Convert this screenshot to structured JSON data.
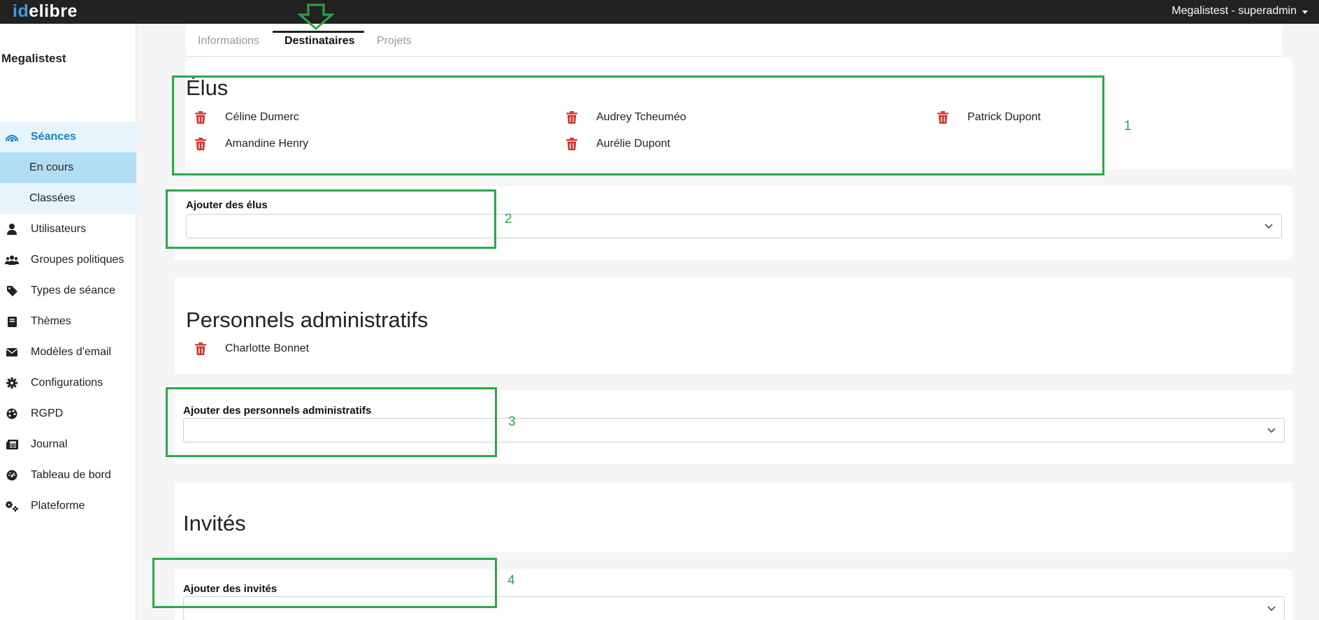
{
  "topbar": {
    "logo_id": "id",
    "logo_rest": "elibre",
    "user_label": "Megalistest - superadmin"
  },
  "sidebar": {
    "structure_name": "Megalistest",
    "items": [
      {
        "label": "Séances",
        "icon": "broadcast-icon"
      },
      {
        "label": "En cours"
      },
      {
        "label": "Classées"
      },
      {
        "label": "Utilisateurs",
        "icon": "user-icon"
      },
      {
        "label": "Groupes politiques",
        "icon": "users-icon"
      },
      {
        "label": "Types de séance",
        "icon": "tag-icon"
      },
      {
        "label": "Thèmes",
        "icon": "book-icon"
      },
      {
        "label": "Modèles d'email",
        "icon": "envelope-icon"
      },
      {
        "label": "Configurations",
        "icon": "gear-icon"
      },
      {
        "label": "RGPD",
        "icon": "palette-icon"
      },
      {
        "label": "Journal",
        "icon": "newspaper-icon"
      },
      {
        "label": "Tableau de bord",
        "icon": "dashboard-icon"
      },
      {
        "label": "Plateforme",
        "icon": "gears-icon"
      }
    ]
  },
  "tabs": [
    {
      "label": "Informations"
    },
    {
      "label": "Destinataires"
    },
    {
      "label": "Projets"
    }
  ],
  "elus": {
    "title": "Élus",
    "members": [
      "Céline Dumerc",
      "Audrey Tcheuméo",
      "Patrick Dupont",
      "Amandine Henry",
      "Aurélie Dupont"
    ],
    "add_label": "Ajouter des élus"
  },
  "personnels": {
    "title": "Personnels administratifs",
    "members": [
      "Charlotte Bonnet"
    ],
    "add_label": "Ajouter des personnels administratifs"
  },
  "invites": {
    "title": "Invités",
    "add_label": "Ajouter des invités"
  },
  "annotations": [
    "1",
    "2",
    "3",
    "4"
  ],
  "colors": {
    "topbar": "#222222",
    "accent": "#1c7fc4",
    "trash": "#d0312d",
    "annotation": "#2aa84a"
  }
}
